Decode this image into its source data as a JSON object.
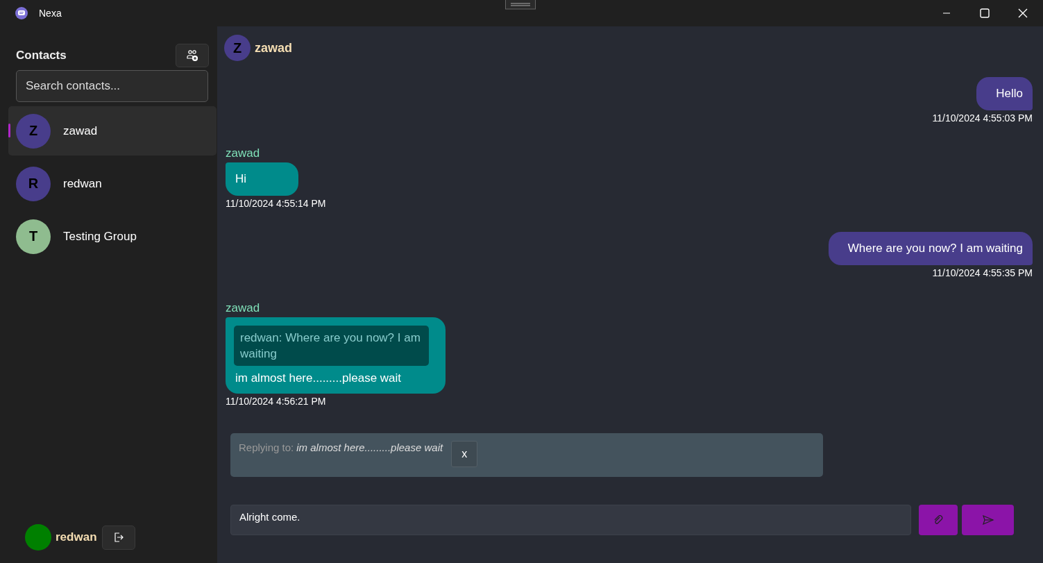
{
  "window": {
    "title": "Nexa"
  },
  "sidebar": {
    "heading": "Contacts",
    "search": {
      "placeholder": "Search contacts..."
    },
    "contacts": [
      {
        "initial": "Z",
        "name": "zawad",
        "color": "#483d8b",
        "selected": true
      },
      {
        "initial": "R",
        "name": "redwan",
        "color": "#483d8b",
        "selected": false
      },
      {
        "initial": "T",
        "name": "Testing Group",
        "color": "#8fbc8f",
        "selected": false
      }
    ],
    "current_user": {
      "name": "redwan",
      "color": "#008000"
    }
  },
  "chat": {
    "header": {
      "initial": "Z",
      "name": "zawad",
      "color": "#483d8b"
    },
    "messages": [
      {
        "kind": "sent",
        "text": "Hello",
        "time": "11/10/2024 4:55:03 PM"
      },
      {
        "kind": "received",
        "sender": "zawad",
        "text": "Hi",
        "time": "11/10/2024 4:55:14 PM"
      },
      {
        "kind": "sent",
        "text": "Where are you now? I am waiting",
        "time": "11/10/2024 4:55:35 PM"
      },
      {
        "kind": "received",
        "sender": "zawad",
        "quote": "redwan: Where are you now? I am waiting",
        "text": "im almost here.........please wait",
        "time": "11/10/2024 4:56:21 PM"
      }
    ],
    "reply_bar": {
      "label": "Replying to:",
      "text": "im almost here.........please wait",
      "close": "x"
    },
    "composer": {
      "value": "Alright come."
    }
  }
}
